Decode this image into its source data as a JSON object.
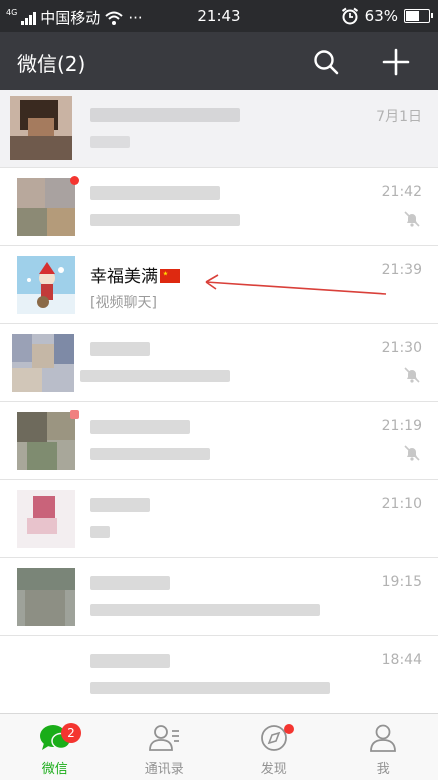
{
  "status_bar": {
    "network": "4G",
    "carrier": "中国移动",
    "more": "···",
    "time": "21:43",
    "battery": "63%",
    "battery_level": 0.63
  },
  "header": {
    "title": "微信(2)"
  },
  "chats": [
    {
      "name": "",
      "preview": "",
      "time": "7月1日",
      "pinned": true,
      "muted": false
    },
    {
      "name": "",
      "preview": "",
      "time": "21:42",
      "pinned": false,
      "muted": true
    },
    {
      "name": "幸福美满",
      "preview": "[视频聊天]",
      "time": "21:39",
      "pinned": false,
      "muted": false
    },
    {
      "name": "",
      "preview": "",
      "time": "21:30",
      "pinned": false,
      "muted": true
    },
    {
      "name": "",
      "preview": "",
      "time": "21:19",
      "pinned": false,
      "muted": true
    },
    {
      "name": "",
      "preview": "",
      "time": "21:10",
      "pinned": false,
      "muted": false
    },
    {
      "name": "",
      "preview": "",
      "time": "19:15",
      "pinned": false,
      "muted": false
    },
    {
      "name": "",
      "preview": "",
      "time": "18:44",
      "pinned": false,
      "muted": false
    }
  ],
  "tabs": [
    {
      "label": "微信",
      "badge": "2",
      "active": true
    },
    {
      "label": "通讯录",
      "active": false
    },
    {
      "label": "发现",
      "active": false
    },
    {
      "label": "我",
      "active": false
    }
  ],
  "colors": {
    "accent": "#1aad19",
    "header_bg": "#393a3f",
    "badge": "#f43530"
  }
}
